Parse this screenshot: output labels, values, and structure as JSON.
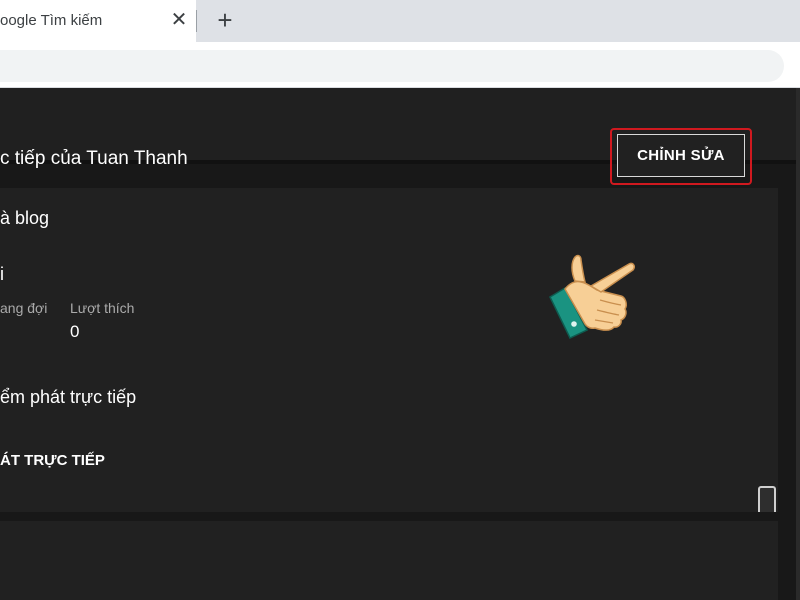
{
  "browser": {
    "tab_title": "oogle Tìm kiếm",
    "tab_close": "✕",
    "new_tab": "+"
  },
  "stream": {
    "title": "c tiếp của Tuan Thanh",
    "description": "à blog",
    "category": "i",
    "edit_button": "CHỈNH SỬA"
  },
  "stats": [
    {
      "label": "ang đợi",
      "value": ""
    },
    {
      "label": "Lượt thích",
      "value": "0"
    }
  ],
  "sections": {
    "checkpoint": "ểm phát trực tiếp",
    "live_settings": "ÁT TRỰC TIẾP"
  },
  "colors": {
    "highlight_border": "#d0191f",
    "hand_cuff": "#1a9381",
    "hand_skin": "#f7cf96"
  },
  "icons": {
    "hand": "pointing-hand-icon"
  }
}
